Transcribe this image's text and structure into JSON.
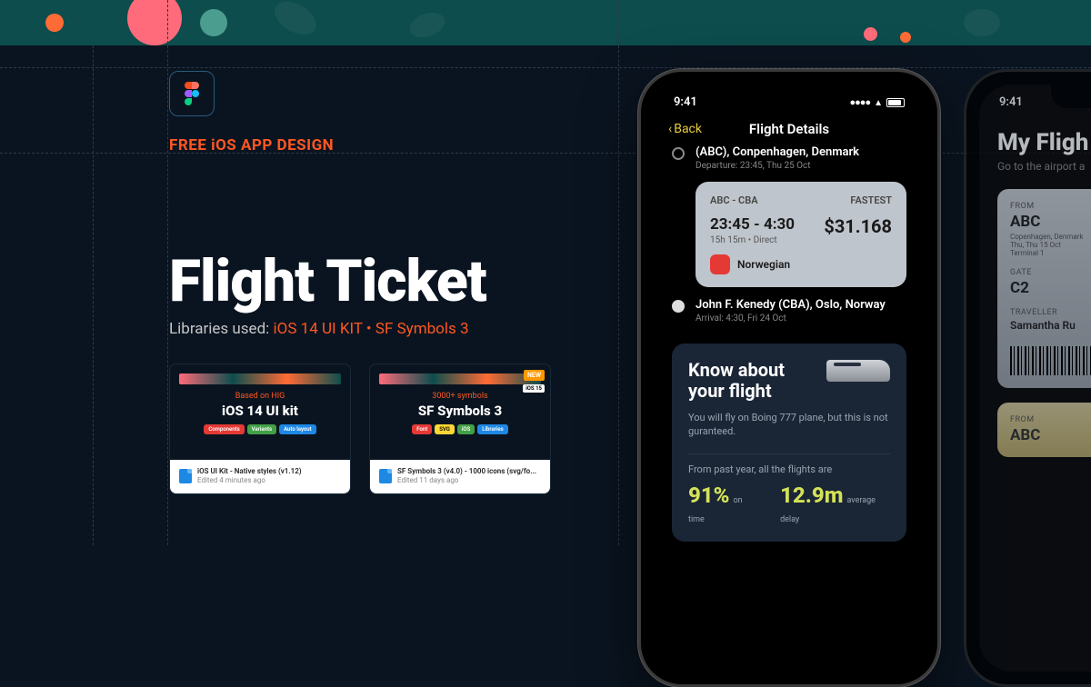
{
  "hero": {
    "tagline": "FREE iOS APP DESIGN",
    "title": "Flight Ticket",
    "libraries_label": "Libraries used:",
    "lib1": "iOS 14 UI KIT",
    "lib2": "SF Symbols 3"
  },
  "libcard1": {
    "based": "Based on HIG",
    "title": "iOS 14 UI kit",
    "pill1": "Components",
    "pill2": "Variants",
    "pill3": "Auto layout",
    "file": "iOS UI Kit - Native styles (v1.12)",
    "edited": "Edited 4 minutes ago"
  },
  "libcard2": {
    "based": "3000+ symbols",
    "title": "SF Symbols 3",
    "new": "NEW",
    "ios15": "iOS 15",
    "pill1": "Font",
    "pill2": "SVG",
    "pill3": "iOS",
    "pill4": "Libraries",
    "file": "SF Symbols 3 (v4.0) - 1000 icons (svg/fo...",
    "edited": "Edited 11 days ago"
  },
  "phone1": {
    "time": "9:41",
    "back": "Back",
    "title": "Flight Details",
    "dep_loc": "(ABC), Conpenhagen, Denmark",
    "dep_sub": "Departure: 23:45, Thu 25 Oct",
    "card_route": "ABC - CBA",
    "card_badge": "FASTEST",
    "card_time": "23:45 - 4:30",
    "card_dur": "15h 15m • Direct",
    "card_price": "$31.168",
    "card_airline": "Norwegian",
    "arr_loc": "John F. Kenedy (CBA), Oslo, Norway",
    "arr_sub": "Arrival: 4:30, Fri 24 Oct",
    "know_title": "Know about your flight",
    "know_sub": "You will fly on Boing 777 plane, but this is not guranteed.",
    "know_stats_label": "From past year, all the flights are",
    "stat1_val": "91%",
    "stat1_lab": "on time",
    "stat2_val": "12.9m",
    "stat2_lab": "average delay"
  },
  "phone2": {
    "time": "9:41",
    "title": "My Fligh",
    "sub": "Go to the airport a",
    "t1_from_label": "FROM",
    "t1_from": "ABC",
    "t1_from_sub": "Copenhagen, Denmark\nThu, Thu 15 Oct\nTerminal 1",
    "t1_gate_label": "GATE",
    "t1_gate": "C2",
    "t1_trav_label": "TRAVELLER",
    "t1_trav": "Samantha Ru",
    "t2_from_label": "FROM",
    "t2_from": "ABC"
  }
}
